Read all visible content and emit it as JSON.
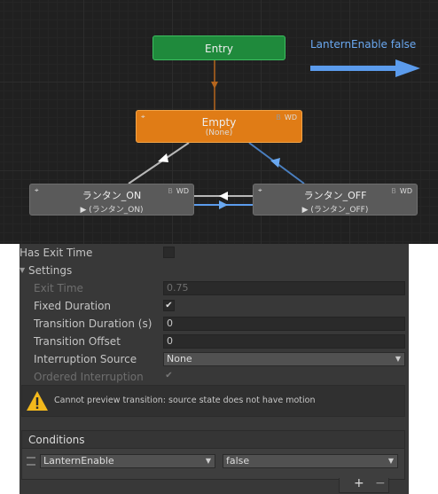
{
  "graph": {
    "entry_label": "Entry",
    "parameter_label": "LanternEnable false",
    "nodes": {
      "empty": {
        "title": "Empty",
        "subtitle": "(None)",
        "flags_b": "B",
        "flags_wd": "WD"
      },
      "on": {
        "title": "ランタン_ON",
        "subtitle": "▶ (ランタン_ON)",
        "flags_b": "B",
        "flags_wd": "WD"
      },
      "off": {
        "title": "ランタン_OFF",
        "subtitle": "▶ (ランタン_OFF)",
        "flags_b": "B",
        "flags_wd": "WD"
      }
    },
    "colors": {
      "entry": "#1f8a3c",
      "default_state": "#e07c16",
      "state": "#5a5a5a",
      "selected_transition": "#5b9bec",
      "transition": "#c8c8c8",
      "entry_transition": "#b5651d"
    }
  },
  "inspector": {
    "has_exit_time": {
      "label": "Has Exit Time",
      "checked": false
    },
    "settings": {
      "header": "Settings",
      "exit_time": {
        "label": "Exit Time",
        "value": "0.75"
      },
      "fixed_duration": {
        "label": "Fixed Duration",
        "checked": true,
        "check_glyph": "✔"
      },
      "transition_duration": {
        "label": "Transition Duration (s)",
        "value": "0"
      },
      "transition_offset": {
        "label": "Transition Offset",
        "value": "0"
      },
      "interruption_source": {
        "label": "Interruption Source",
        "value": "None"
      },
      "ordered_interruption": {
        "label": "Ordered Interruption",
        "checked": true,
        "check_glyph": "✔"
      }
    },
    "warning": {
      "icon": "warning-icon",
      "message": "Cannot preview transition: source state does not have motion"
    },
    "conditions": {
      "header": "Conditions",
      "items": [
        {
          "parameter": "LanternEnable",
          "value": "false"
        }
      ],
      "add_label": "+",
      "remove_label": "−"
    }
  }
}
